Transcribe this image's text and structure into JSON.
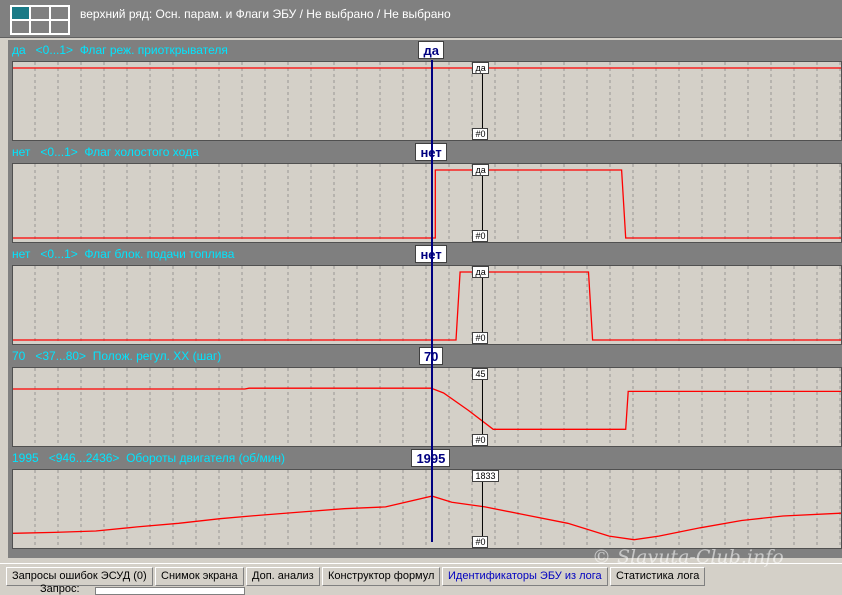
{
  "title": "верхний ряд: Осн. парам. и Флаги ЭБУ / Не выбрано / Не выбрано",
  "colors": {
    "header_text": "#00e5ff",
    "trace": "#ff0000",
    "cursor": "#000080",
    "marker": "#000000",
    "grid": "#888888"
  },
  "x_range": [
    0,
    100
  ],
  "cursor_x": 50.6,
  "marker_x": 56.7,
  "panels": [
    {
      "current": "да",
      "range": "<0...1>",
      "name": "Флаг реж. приоткрывателя",
      "cursor_value": "да",
      "scale_top": "да",
      "scale_bottom": "#0",
      "y_range": [
        0,
        1
      ],
      "trace": [
        [
          0,
          1
        ],
        [
          100,
          1
        ]
      ]
    },
    {
      "current": "нет",
      "range": "<0...1>",
      "name": "Флаг холостого хода",
      "cursor_value": "нет",
      "scale_top": "да",
      "scale_bottom": "#0",
      "y_range": [
        0,
        1
      ],
      "trace": [
        [
          0,
          0
        ],
        [
          51,
          0
        ],
        [
          51,
          1
        ],
        [
          73.5,
          1
        ],
        [
          74,
          0
        ],
        [
          100,
          0
        ]
      ]
    },
    {
      "current": "нет",
      "range": "<0...1>",
      "name": "Флаг блок. подачи топлива",
      "cursor_value": "нет",
      "scale_top": "да",
      "scale_bottom": "#0",
      "y_range": [
        0,
        1
      ],
      "trace": [
        [
          0,
          0
        ],
        [
          53.5,
          0
        ],
        [
          54,
          1
        ],
        [
          69.5,
          1
        ],
        [
          70,
          0
        ],
        [
          100,
          0
        ]
      ]
    },
    {
      "current": "70",
      "range": "<37...80>",
      "name": "Полож. регул. XX (шаг)",
      "cursor_value": "70",
      "scale_top": "45",
      "scale_bottom": "#0",
      "y_range": [
        37,
        80
      ],
      "trace": [
        [
          0,
          70.5
        ],
        [
          28,
          70.5
        ],
        [
          28.5,
          71
        ],
        [
          50.5,
          71
        ],
        [
          52,
          68
        ],
        [
          55,
          57
        ],
        [
          58,
          45
        ],
        [
          74,
          45
        ],
        [
          74.3,
          69
        ],
        [
          100,
          69
        ]
      ]
    },
    {
      "current": "1995",
      "range": "<946...2436>",
      "name": "Обороты двигателя (об/мин)",
      "cursor_value": "1995",
      "scale_top": "1833",
      "scale_bottom": "#0",
      "y_range": [
        946,
        2436
      ],
      "trace": [
        [
          0,
          1180
        ],
        [
          5,
          1200
        ],
        [
          10,
          1230
        ],
        [
          15,
          1320
        ],
        [
          20,
          1400
        ],
        [
          25,
          1500
        ],
        [
          30,
          1580
        ],
        [
          35,
          1650
        ],
        [
          40,
          1720
        ],
        [
          45,
          1760
        ],
        [
          50.6,
          1995
        ],
        [
          53,
          1860
        ],
        [
          57,
          1760
        ],
        [
          62,
          1580
        ],
        [
          67,
          1400
        ],
        [
          72,
          1120
        ],
        [
          75,
          1040
        ],
        [
          78,
          1120
        ],
        [
          83,
          1300
        ],
        [
          88,
          1460
        ],
        [
          93,
          1560
        ],
        [
          100,
          1620
        ]
      ]
    }
  ],
  "tabs": [
    {
      "label": "Запросы ошибок ЭСУД (0)",
      "active": false
    },
    {
      "label": "Снимок экрана",
      "active": false
    },
    {
      "label": "Доп. анализ",
      "active": false
    },
    {
      "label": "Конструктор формул",
      "active": false
    },
    {
      "label": "Идентификаторы ЭБУ из лога",
      "active": true
    },
    {
      "label": "Статистика лога",
      "active": false
    }
  ],
  "query_label": "Запрос:",
  "watermark": "© Slavuta-Club.info"
}
